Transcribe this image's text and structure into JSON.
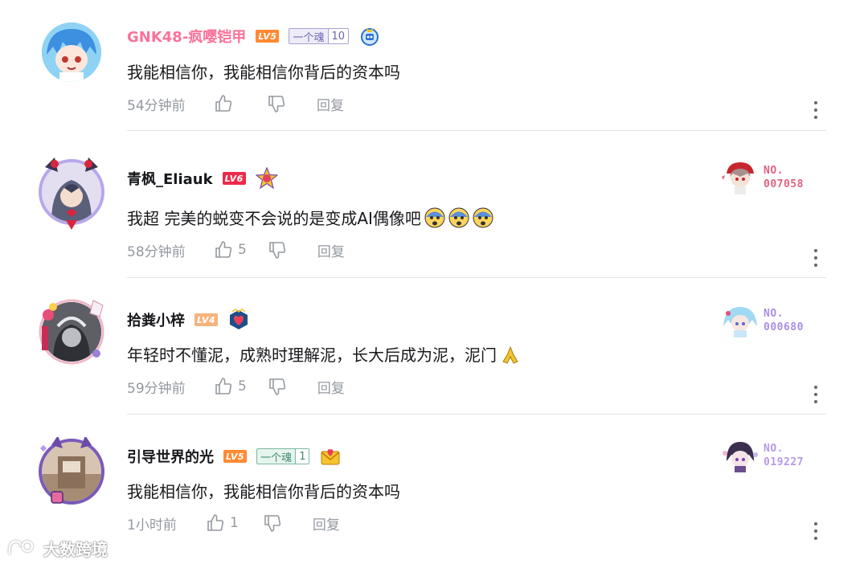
{
  "comments": [
    {
      "username": "GNK48-疯嘤铠甲",
      "level": "LV5",
      "fan_badge": {
        "name": "一个魂",
        "level": "10"
      },
      "text": "我能相信你，我能相信你背后的资本吗",
      "time": "54分钟前",
      "likes": "",
      "reply_label": "回复"
    },
    {
      "username": "青枫_Eliauk",
      "level": "LV6",
      "text": "我超 完美的蜕变不会说的是变成AI偶像吧",
      "time": "58分钟前",
      "likes": "5",
      "reply_label": "回复",
      "badge": {
        "line1": "NO.",
        "line2": "007058",
        "color": "#e0627f"
      }
    },
    {
      "username": "拾粪小梓",
      "level": "LV4",
      "text": "年轻时不懂泥，成熟时理解泥，长大后成为泥，泥门",
      "time": "59分钟前",
      "likes": "5",
      "reply_label": "回复",
      "badge": {
        "line1": "NO.",
        "line2": "000680",
        "color": "#a98ee8"
      }
    },
    {
      "username": "引导世界的光",
      "level": "LV5",
      "fan_badge": {
        "name": "一个魂",
        "level": "1"
      },
      "text": "我能相信你，我能相信你背后的资本吗",
      "time": "1小时前",
      "likes": "1",
      "reply_label": "回复",
      "badge": {
        "line1": "NO.",
        "line2": "019227",
        "color": "#b59ae8"
      }
    }
  ],
  "watermark": "大数跨境",
  "colors": {
    "vip_name": "#fb7299",
    "lv4": "#f6b37e",
    "lv5": "#ff8a33",
    "lv6": "#ee2a4a",
    "muted": "#9499a0",
    "divider": "#e3e5e7"
  }
}
